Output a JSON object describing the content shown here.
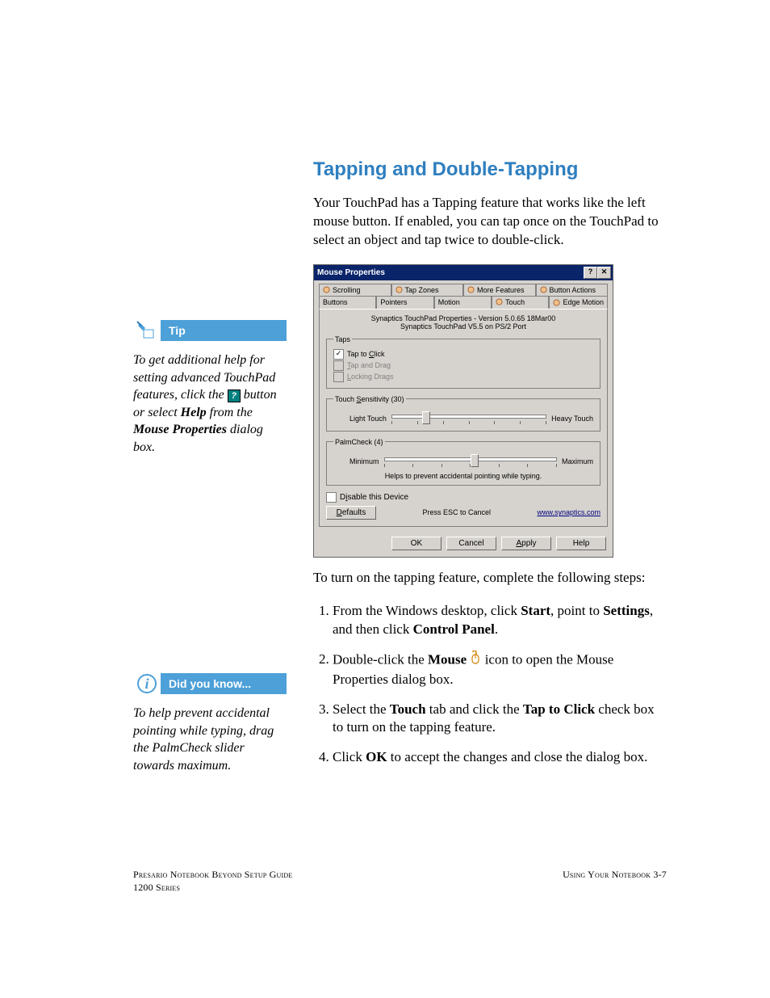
{
  "heading": "Tapping and Double-Tapping",
  "intro": "Your TouchPad has a Tapping feature that works like the left mouse button. If enabled, you can tap once on the TouchPad to select an object and tap twice to double-click.",
  "after_dialog": "To turn on the tapping feature, complete the following steps:",
  "steps": [
    {
      "pre": "From the Windows desktop, click ",
      "b1": "Start",
      "mid1": ", point to ",
      "b2": "Settings",
      "mid2": ", and then click ",
      "b3": "Control Panel",
      "post": "."
    },
    {
      "pre": "Double-click the ",
      "b1": "Mouse",
      "post": " icon to open the Mouse Properties dialog box."
    },
    {
      "pre": "Select the ",
      "b1": "Touch",
      "mid1": " tab and click the ",
      "b2": "Tap to Click",
      "post": " check box to turn on the tapping feature."
    },
    {
      "pre": "Click ",
      "b1": "OK",
      "post": " to accept the changes and close the dialog box."
    }
  ],
  "tip": {
    "label": "Tip",
    "t1": "To get additional help for setting advanced TouchPad features, click the ",
    "t2": " button or select ",
    "b1": "Help",
    "t3": " from the ",
    "b2": "Mouse Properties",
    "t4": " dialog box.",
    "help_glyph": "?"
  },
  "dyk": {
    "label": "Did you know...",
    "text": "To help prevent accidental pointing while typing, drag the PalmCheck slider towards maximum."
  },
  "dialog": {
    "title": "Mouse Properties",
    "help": "?",
    "close": "✕",
    "tabs_row1": [
      "Scrolling",
      "Tap Zones",
      "More Features",
      "Button Actions"
    ],
    "tabs_row2": [
      "Buttons",
      "Pointers",
      "Motion",
      "Touch",
      "Edge Motion"
    ],
    "info1": "Synaptics TouchPad Properties - Version 5.0.65 18Mar00",
    "info2": "Synaptics TouchPad V5.5 on PS/2 Port",
    "taps": {
      "legend": "Taps",
      "items": [
        {
          "label_pre": "Tap to ",
          "u": "C",
          "label_post": "lick",
          "checked": true,
          "disabled": false
        },
        {
          "label_pre": "",
          "u": "T",
          "label_post": "ap and Drag",
          "checked": false,
          "disabled": true
        },
        {
          "label_pre": "",
          "u": "L",
          "label_post": "ocking Drags",
          "checked": false,
          "disabled": true
        }
      ]
    },
    "sensitivity": {
      "legend_pre": "Touch ",
      "legend_u": "S",
      "legend_post": "ensitivity (30)",
      "left": "Light Touch",
      "right": "Heavy Touch",
      "pos": 20
    },
    "palmcheck": {
      "legend": "PalmCheck (4)",
      "left": "Minimum",
      "right": "Maximum",
      "pos": 50,
      "helper": "Helps to prevent accidental pointing while typing."
    },
    "disable_u": "i",
    "disable_pre": "D",
    "disable_post": "sable this Device",
    "defaults_u": "D",
    "defaults_post": "efaults",
    "esc": "Press ESC to Cancel",
    "link": "www.synaptics.com",
    "buttons": {
      "ok": "OK",
      "cancel": "Cancel",
      "apply_u": "A",
      "apply_post": "pply",
      "help": "Help"
    }
  },
  "footer": {
    "left1": "Presario Notebook Beyond Setup Guide",
    "left2": "1200 Series",
    "right": "Using Your Notebook   3-7"
  }
}
